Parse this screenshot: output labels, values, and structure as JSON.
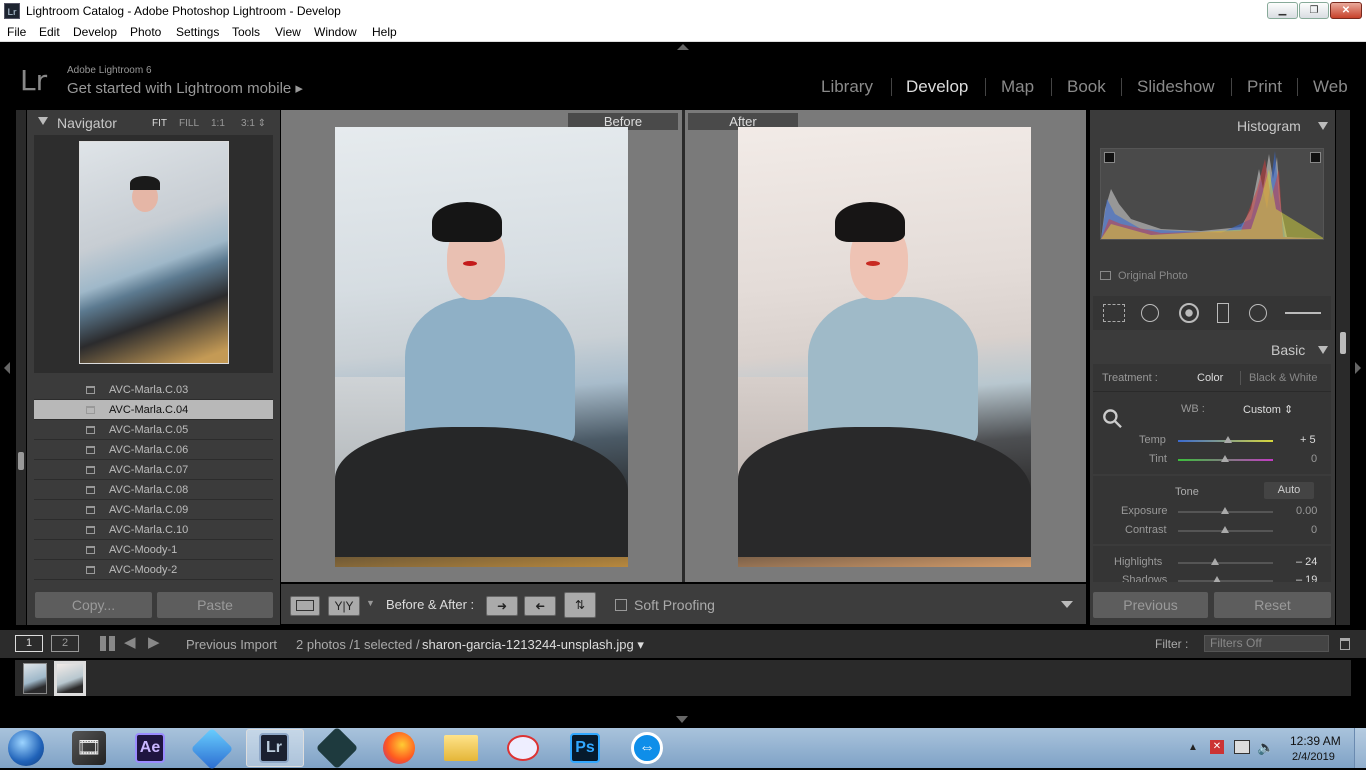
{
  "window": {
    "title": "Lightroom Catalog - Adobe Photoshop Lightroom - Develop",
    "app_icon_text": "Lr"
  },
  "menu": [
    "File",
    "Edit",
    "Develop",
    "Photo",
    "Settings",
    "Tools",
    "View",
    "Window",
    "Help"
  ],
  "header": {
    "logo": "Lr",
    "version": "Adobe Lightroom 6",
    "mobile": "Get started with Lightroom mobile ▸",
    "modules": [
      "Library",
      "Develop",
      "Map",
      "Book",
      "Slideshow",
      "Print",
      "Web"
    ],
    "active_module": "Develop"
  },
  "navigator": {
    "title": "Navigator",
    "zoom_options": [
      "FIT",
      "FILL",
      "1:1",
      "3:1 ⇕"
    ]
  },
  "presets": {
    "items": [
      "AVC-Marla.C.03",
      "AVC-Marla.C.04",
      "AVC-Marla.C.05",
      "AVC-Marla.C.06",
      "AVC-Marla.C.07",
      "AVC-Marla.C.08",
      "AVC-Marla.C.09",
      "AVC-Marla.C.10",
      "AVC-Moody-1",
      "AVC-Moody-2"
    ],
    "selected_index": 1
  },
  "left_buttons": {
    "copy": "Copy...",
    "paste": "Paste"
  },
  "view": {
    "before_label": "Before",
    "after_label": "After"
  },
  "toolbar": {
    "yy_label": "Y|Y",
    "before_after_label": "Before & After :",
    "soft_proofing": "Soft Proofing"
  },
  "histogram": {
    "title": "Histogram",
    "original_photo": "Original Photo"
  },
  "basic": {
    "title": "Basic",
    "treatment_label": "Treatment :",
    "color": "Color",
    "bw": "Black & White",
    "wb_label": "WB :",
    "wb_value": "Custom ⇕",
    "tone_label": "Tone",
    "auto_label": "Auto",
    "sliders": [
      {
        "label": "Temp",
        "value": "+ 5"
      },
      {
        "label": "Tint",
        "value": "0"
      },
      {
        "label": "Exposure",
        "value": "0.00"
      },
      {
        "label": "Contrast",
        "value": "0"
      },
      {
        "label": "Highlights",
        "value": "– 24"
      },
      {
        "label": "Shadows",
        "value": "– 19"
      }
    ]
  },
  "right_buttons": {
    "previous": "Previous",
    "reset": "Reset"
  },
  "filmbar": {
    "screen1": "1",
    "screen2": "2",
    "source": "Previous Import",
    "count": "2 photos /1 selected /",
    "filename": "sharon-garcia-1213244-unsplash.jpg ▾",
    "filter_label": "Filter :",
    "filter_value": "Filters Off"
  },
  "taskbar": {
    "time": "12:39 AM",
    "date": "2/4/2019",
    "ae": "Ae",
    "lr": "Lr",
    "ps": "Ps"
  },
  "colors": {
    "panel": "#3b3b3b",
    "center": "#7a7a7a",
    "taskbar": "#8fb0d0"
  }
}
